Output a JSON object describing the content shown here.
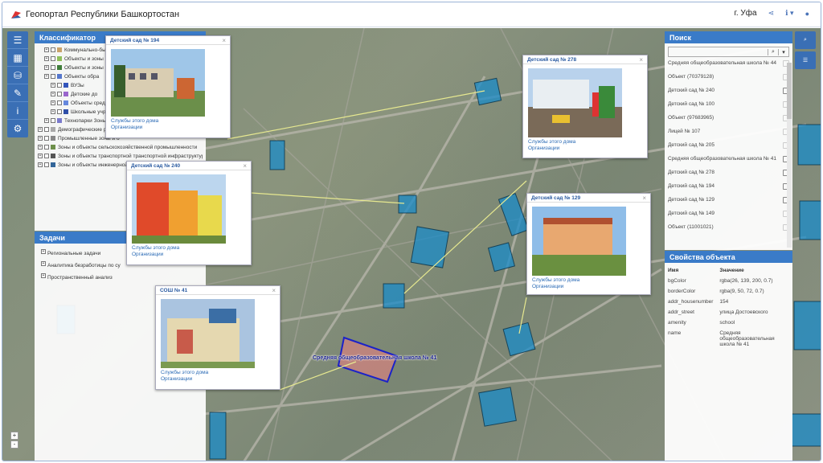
{
  "header": {
    "title": "Геопортал Республики Башкортостан",
    "city": "г. Уфа",
    "share_icon": "share-icon",
    "info_icon": "info-icon",
    "user_icon": "user-icon"
  },
  "left_toolbar": [
    "menu-icon",
    "grid-icon",
    "database-icon",
    "edit-icon",
    "info-icon",
    "gear-icon"
  ],
  "classifier": {
    "title": "Классификатор",
    "items": [
      {
        "label": "Коммунально-бытовые предприятия и",
        "color": "#c9a36a"
      },
      {
        "label": "Объекты и зоны назначения",
        "color": "#8fbf5a"
      },
      {
        "label": "Объекты и зоны коммерческие",
        "color": "#3f7d3a"
      },
      {
        "label": "Объекты обра",
        "color": "#5577cc"
      },
      {
        "label": "ВУЗы",
        "color": "#3355bb"
      },
      {
        "label": "Детские до",
        "color": "#9a66cc"
      },
      {
        "label": "Объекты средн высшего пр",
        "color": "#6688dd"
      },
      {
        "label": "Школьные учреждения",
        "color": "#2f4fa8"
      },
      {
        "label": "Технопарки Зоны и организации научно исследовательские проектные и конструкторские",
        "color": "#7a7acc"
      },
      {
        "label": "Демографические ресурсы",
        "color": "#aaaaaa"
      },
      {
        "label": "Промышленные зоны и о",
        "color": "#888888"
      },
      {
        "label": "Зоны и объекты сельскохозяйственной промышленности",
        "color": "#6d8f4a"
      },
      {
        "label": "Зоны и объекты транспортной транспортной инфраструктуры",
        "color": "#555555"
      },
      {
        "label": "Зоны и объекты инженерной инфраструктуры",
        "color": "#336699"
      }
    ]
  },
  "tasks": {
    "title": "Задачи",
    "items": [
      "Региональные задачи",
      "Аналитика безработицы по су",
      "Пространственный анализ"
    ]
  },
  "search": {
    "title": "Поиск",
    "value": "",
    "results": [
      "Средняя общеобразовательная школа № 44",
      "Объект (70379128)",
      "Детский сад № 240",
      "Детский сад № 100",
      "Объект (97683965)",
      "Лицей № 107",
      "Детский сад № 205",
      "Средняя общеобразовательная школа № 41",
      "Детский сад № 278",
      "Детский сад № 194",
      "Детский сад № 129",
      "Детский сад № 149",
      "Объект (11001021)"
    ]
  },
  "properties": {
    "title": "Свойства объекта",
    "col_name": "Имя",
    "col_value": "Значение",
    "rows": [
      {
        "name": "bgColor",
        "value": "rgba(26, 139, 200, 0.7)"
      },
      {
        "name": "borderColor",
        "value": "rgba(9, 50, 72, 0.7)"
      },
      {
        "name": "addr_housenumber",
        "value": "154"
      },
      {
        "name": "addr_street",
        "value": "улица Достоевского"
      },
      {
        "name": "amenity",
        "value": "school"
      },
      {
        "name": "name",
        "value": "Средняя общеобразовательная школа № 41"
      }
    ]
  },
  "popups": [
    {
      "title": "Детский сад № 194",
      "link1": "Службы этого дома",
      "link2": "Организации"
    },
    {
      "title": "Детский сад № 278",
      "link1": "Службы этого дома",
      "link2": "Организации"
    },
    {
      "title": "Детский сад № 240",
      "link1": "Службы этого дома",
      "link2": "Организации"
    },
    {
      "title": "Детский сад № 129",
      "link1": "Службы этого дома",
      "link2": "Организации"
    },
    {
      "title": "СОШ № 41",
      "link1": "Службы этого дома",
      "link2": "Организации"
    }
  ],
  "map_label": "Средняя общеобразовательная школа № 41",
  "zoom": {
    "in": "+",
    "out": "-"
  },
  "colors": {
    "accent": "#3a7bc8",
    "building_fill": "#1a8bc8",
    "highlight_border": "#1c22c8"
  }
}
